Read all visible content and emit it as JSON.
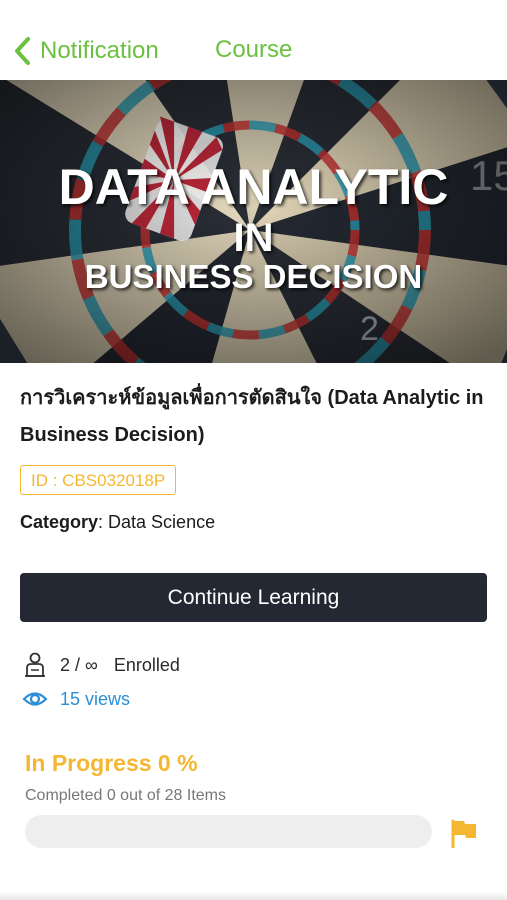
{
  "header": {
    "back_label": "Notification",
    "course_tab": "Course"
  },
  "banner": {
    "line1": "DATA ANALYTIC",
    "line2": "IN",
    "line3": "BUSINESS DECISION"
  },
  "course": {
    "title": "การวิเคราะห์ข้อมูลเพื่อการตัดสินใจ (Data Analytic in Business Decision)",
    "id_badge": "ID : CBS032018P",
    "category_label": "Category",
    "category_value": ": Data Science"
  },
  "actions": {
    "continue_label": "Continue Learning"
  },
  "stats": {
    "enrolled_count": "2 / ∞",
    "enrolled_label": "Enrolled",
    "views": "15 views"
  },
  "progress": {
    "title": "In Progress 0 %",
    "subtitle": "Completed 0 out of 28 Items",
    "percent": 0
  },
  "colors": {
    "accent_green": "#6ac13f",
    "accent_orange": "#f5b731",
    "link_blue": "#2b8fd6",
    "button_dark": "#232833"
  },
  "icons": {
    "back": "chevron-left-icon",
    "enrolled": "person-icon",
    "views": "eye-icon",
    "flag": "flag-icon"
  }
}
